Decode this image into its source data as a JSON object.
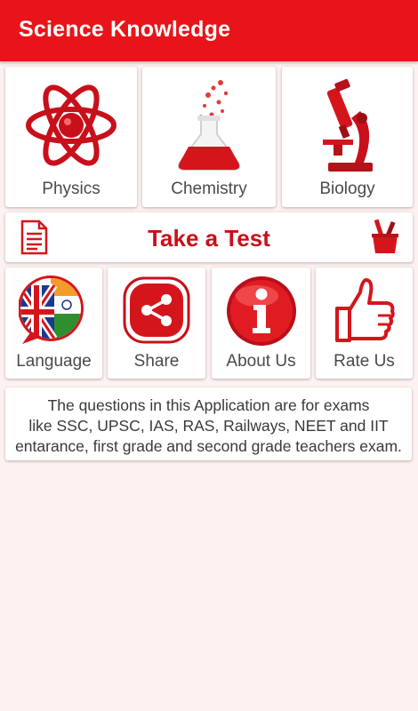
{
  "app": {
    "title": "Science Knowledge"
  },
  "subjects": [
    {
      "label": "Physics",
      "icon": "atom-icon"
    },
    {
      "label": "Chemistry",
      "icon": "flask-icon"
    },
    {
      "label": "Biology",
      "icon": "microscope-icon"
    }
  ],
  "test": {
    "label": "Take a Test",
    "left_icon": "document-icon",
    "right_icon": "pencil-cup-icon"
  },
  "utilities": [
    {
      "label": "Language",
      "icon": "flags-language-icon"
    },
    {
      "label": "Share",
      "icon": "share-icon"
    },
    {
      "label": "About Us",
      "icon": "info-icon"
    },
    {
      "label": "Rate Us",
      "icon": "thumbs-up-icon"
    }
  ],
  "info": {
    "lines": [
      "The questions in this Application are for exams",
      "like SSC, UPSC, IAS, RAS, Railways, NEET and IIT",
      "entarance, first grade and second grade teachers exam."
    ]
  },
  "colors": {
    "brand": "#e8141a",
    "accent_dark": "#c8101a",
    "background": "#fdf1f1"
  }
}
